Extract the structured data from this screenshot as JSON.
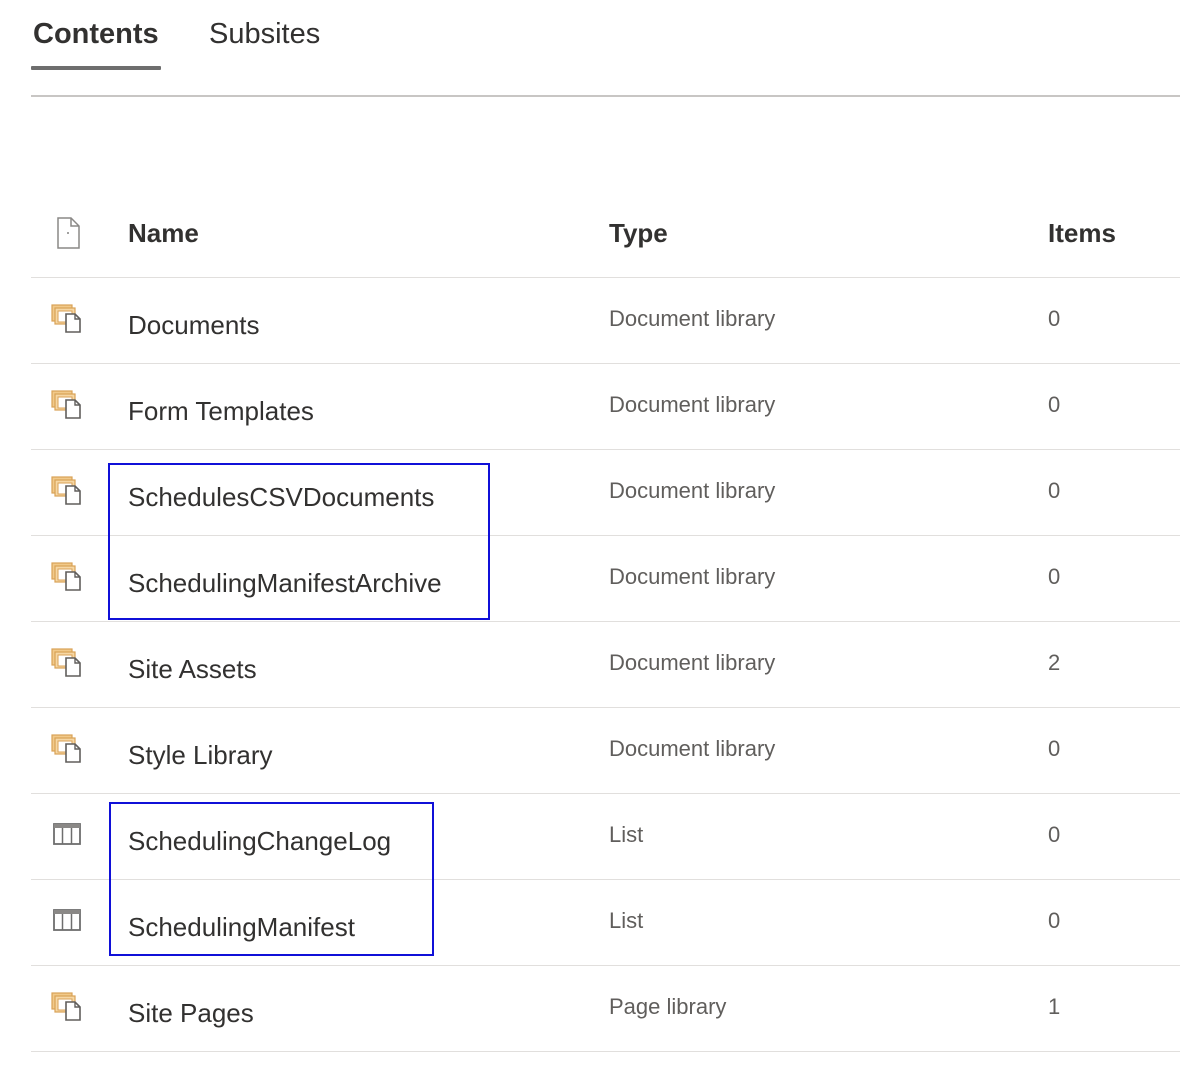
{
  "tabs": [
    {
      "label": "Contents",
      "active": true
    },
    {
      "label": "Subsites",
      "active": false
    }
  ],
  "table": {
    "headers": {
      "name": "Name",
      "type": "Type",
      "items": "Items"
    },
    "rows": [
      {
        "name": "Documents",
        "type": "Document library",
        "items": "0",
        "icon": "library-icon"
      },
      {
        "name": "Form Templates",
        "type": "Document library",
        "items": "0",
        "icon": "library-icon"
      },
      {
        "name": "SchedulesCSVDocuments",
        "type": "Document library",
        "items": "0",
        "icon": "library-icon"
      },
      {
        "name": "SchedulingManifestArchive",
        "type": "Document library",
        "items": "0",
        "icon": "library-icon"
      },
      {
        "name": "Site Assets",
        "type": "Document library",
        "items": "2",
        "icon": "library-icon"
      },
      {
        "name": "Style Library",
        "type": "Document library",
        "items": "0",
        "icon": "library-icon"
      },
      {
        "name": "SchedulingChangeLog",
        "type": "List",
        "items": "0",
        "icon": "list-icon"
      },
      {
        "name": "SchedulingManifest",
        "type": "List",
        "items": "0",
        "icon": "list-icon"
      },
      {
        "name": "Site Pages",
        "type": "Page library",
        "items": "1",
        "icon": "library-icon"
      }
    ]
  },
  "colors": {
    "highlight": "#1010d8",
    "library_icon": "#e6b066",
    "list_icon": "#6e6e6e"
  }
}
